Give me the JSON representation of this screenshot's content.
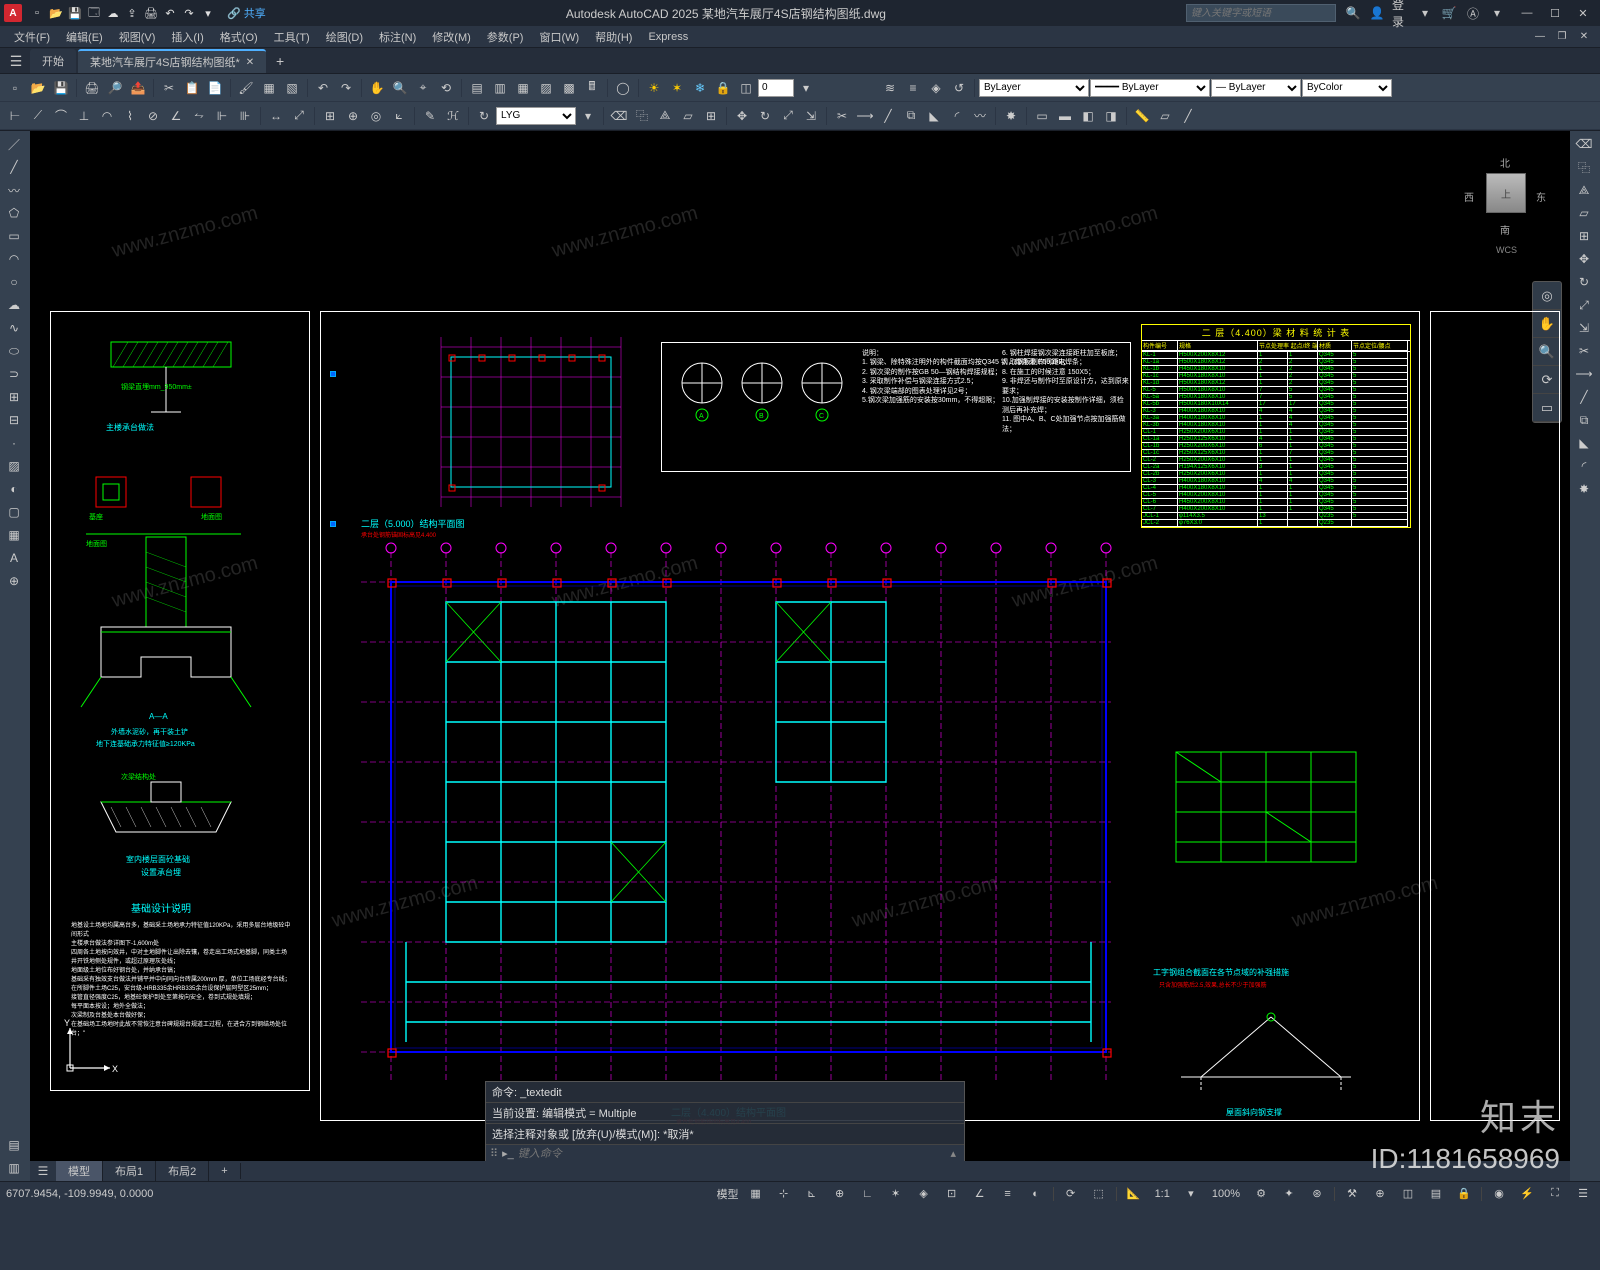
{
  "app": {
    "name": "Autodesk AutoCAD 2025",
    "document": "某地汽车展厅4S店钢结构图纸.dwg",
    "title": "Autodesk AutoCAD 2025    某地汽车展厅4S店钢结构图纸.dwg",
    "search_placeholder": "键入关键字或短语",
    "login": "登录",
    "share": "共享"
  },
  "menus": [
    "文件(F)",
    "编辑(E)",
    "视图(V)",
    "插入(I)",
    "格式(O)",
    "工具(T)",
    "绘图(D)",
    "标注(N)",
    "修改(M)",
    "参数(P)",
    "窗口(W)",
    "帮助(H)",
    "Express"
  ],
  "filetabs": {
    "start": "开始",
    "active": "某地汽车展厅4S店钢结构图纸*"
  },
  "ribbon": {
    "layer_current": "LYG",
    "num_input": "0",
    "prop1": "ByLayer",
    "prop2": "ByLayer",
    "prop3": "ByLayer",
    "prop4": "ByColor"
  },
  "viewcube": {
    "face": "上",
    "n": "北",
    "s": "南",
    "e": "东",
    "w": "西",
    "wcs": "WCS"
  },
  "command": {
    "line1": "命令: _textedit",
    "line2": "当前设置: 编辑模式 = Multiple",
    "line3": "选择注释对象或 [放弃(U)/模式(M)]: *取消*",
    "prompt_placeholder": "键入命令"
  },
  "modeltabs": [
    "模型",
    "布局1",
    "布局2"
  ],
  "status": {
    "coords": "6707.9454, -109.9949, 0.0000",
    "scale": "1:1",
    "pct": "100%"
  },
  "drawing": {
    "sheet_detail_title": "基础设计说明",
    "section_label": "A—A",
    "section_note1": "外墙水泥砂，再干装土铲",
    "section_note2": "地下连基础承力特征值≥120KPa",
    "detail1": "主楼承台做法",
    "detail2": "室内楼层面砼基础",
    "detail3": "设置承台埋",
    "plan_title": "二层（4.400）结构平面图",
    "plan_title2": "二层（5.000）结构平面图",
    "plan_note": "承台处钢筋锚固标高见4.400",
    "table_title": "二 层（4.400）梁 材 料 统 计 表",
    "table_headers": [
      "构件编号",
      "规格",
      "节点处理率 起点/终 端下",
      "材质",
      "节点定位/腰点"
    ],
    "table_rows": [
      [
        "KL-1",
        "H500X200X8X12",
        "1",
        "1",
        "Q345",
        "5"
      ],
      [
        "KL-1a",
        "H500X180X8X12",
        "2",
        "2",
        "Q345",
        "5"
      ],
      [
        "KL-1b",
        "H450X180X8X10",
        "1",
        "2",
        "Q345",
        "5"
      ],
      [
        "KL-1c",
        "H450X180X8X10",
        "1",
        "2",
        "Q345",
        "5"
      ],
      [
        "KL-1d",
        "H500X180X8X12",
        "1",
        "2",
        "Q345",
        "5"
      ],
      [
        "KL-5",
        "H500X180X8X10",
        "7",
        "5",
        "Q345",
        "5"
      ],
      [
        "KL-5a",
        "H500X180X8X10",
        "7",
        "5",
        "Q345",
        "5"
      ],
      [
        "KL-5b",
        "H500X180X10X14",
        "17",
        "17",
        "Q345",
        "5"
      ],
      [
        "KL-3",
        "H400X180X8X10",
        "4",
        "4",
        "Q345",
        "5"
      ],
      [
        "KL-3a",
        "H400X180X8X10",
        "1",
        "4",
        "Q345",
        "5"
      ],
      [
        "KL-3b",
        "H400X180X8X10",
        "1",
        "4",
        "Q345",
        "5"
      ],
      [
        "CL-1",
        "H250X200X6X10",
        "1",
        "1",
        "Q345",
        "5"
      ],
      [
        "CL-1a",
        "H250X125X6X10",
        "4",
        "1",
        "Q345",
        "5"
      ],
      [
        "CL-1b",
        "H250X200X6X10",
        "6",
        "1",
        "Q345",
        "5"
      ],
      [
        "CL-1c",
        "H250X125X6X10",
        "1",
        "7",
        "Q345",
        "5"
      ],
      [
        "CL-2",
        "H250X200X6X10",
        "1",
        "1",
        "Q345",
        "5"
      ],
      [
        "CL-2a",
        "H194X125X6X10",
        "3",
        "1",
        "Q345",
        "5"
      ],
      [
        "CL-2b",
        "H250X200X6X10",
        "1",
        "1",
        "Q345",
        "5"
      ],
      [
        "CL-3",
        "H400X180X8X10",
        "4",
        "4",
        "Q345",
        "5"
      ],
      [
        "CL-4",
        "H400X180X8X10",
        "1",
        "1",
        "Q345",
        "5"
      ],
      [
        "CL-5",
        "H400X200X8X10",
        "1",
        "1",
        "Q345",
        "5"
      ],
      [
        "CL-6",
        "H450X200X8X10",
        "1",
        "1",
        "Q345",
        "5"
      ],
      [
        "CL-7",
        "H400X200X8X10",
        "1",
        "1",
        "Q345",
        "5"
      ],
      [
        "JCL-1",
        "φ114X3.5",
        "13",
        "",
        "Q235",
        "5"
      ],
      [
        "JCL-2",
        "φ76X3.0",
        "1",
        "",
        "Q235",
        ""
      ]
    ],
    "note_box_title": "说明：",
    "notes": [
      "1. 钢梁、除特殊注明外的构件截面均按Q345 钢，焊条采 E5003电焊条；",
      "2. 钢次梁的制作按GB 50—钢结构焊接规程；",
      "3. 采取制作补偿与钢梁连接方式2.5；",
      "4. 钢次梁端部的图表处理详见2号；",
      "5.钢次梁加强筋的安装按30mm，不得超限；",
      "6. 钢柱焊接钢次梁连接距柱加至板底；",
      "7. 取钢板制作间距2；",
      "8. 在施工的时候注意 150X5；",
      "9. 非焊还与制作时至原设计方，达到原来要求；",
      "10.加强制焊接的安装按制作详细，须检测后再补充焊；",
      "11. 图中A、B、C处加强节点按加强筋做法；"
    ],
    "detail_diagram_title": "工字钢组合截面在各节点域的补强措施",
    "detail_diagram_sub": "只含加强筋后2.5,效果,总长不少于加强筋",
    "brace_detail": "屋面斜向钢支撑"
  },
  "overlay": {
    "brand": "知末",
    "id": "ID:1181658969",
    "wm": "www.znzmo.com"
  }
}
